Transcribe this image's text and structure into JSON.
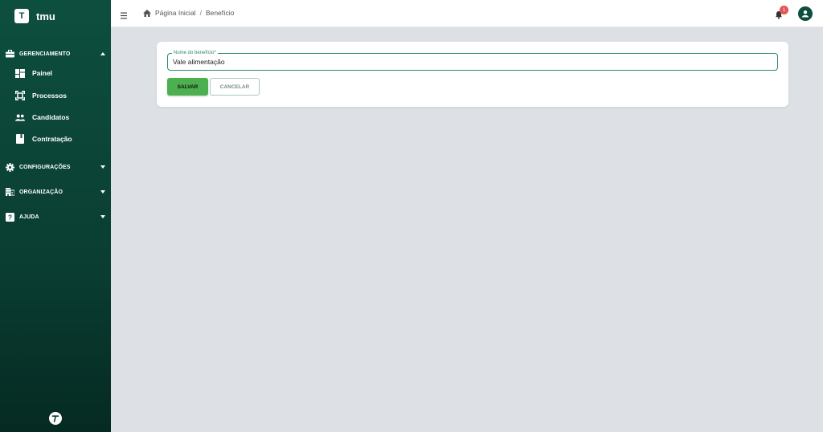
{
  "brand": {
    "logo_letter": "T",
    "name": "tmu"
  },
  "sidebar": {
    "sections": [
      {
        "label": "GERENCIAMENTO",
        "icon": "briefcase-icon",
        "expanded": true
      },
      {
        "label": "CONFIGURAÇÕES",
        "icon": "gear-icon",
        "expanded": false
      },
      {
        "label": "ORGANIZAÇÃO",
        "icon": "building-icon",
        "expanded": false
      },
      {
        "label": "AJUDA",
        "icon": "help-icon",
        "expanded": false
      }
    ],
    "items": [
      {
        "label": "Painel",
        "icon": "dashboard-icon"
      },
      {
        "label": "Processos",
        "icon": "process-icon"
      },
      {
        "label": "Candidatos",
        "icon": "people-icon"
      },
      {
        "label": "Contratação",
        "icon": "book-icon"
      }
    ]
  },
  "topbar": {
    "breadcrumb": [
      "Página Inicial",
      "Benefício"
    ],
    "notifications_count": "1"
  },
  "form": {
    "field_label": "Nome do benefício*",
    "field_value": "Vale alimentação",
    "save_label": "SALVAR",
    "cancel_label": "CANCELAR"
  },
  "colors": {
    "sidebar": "#0d4f3f",
    "accent": "#2a8a73",
    "save": "#4caf50",
    "badge": "#e55353"
  }
}
